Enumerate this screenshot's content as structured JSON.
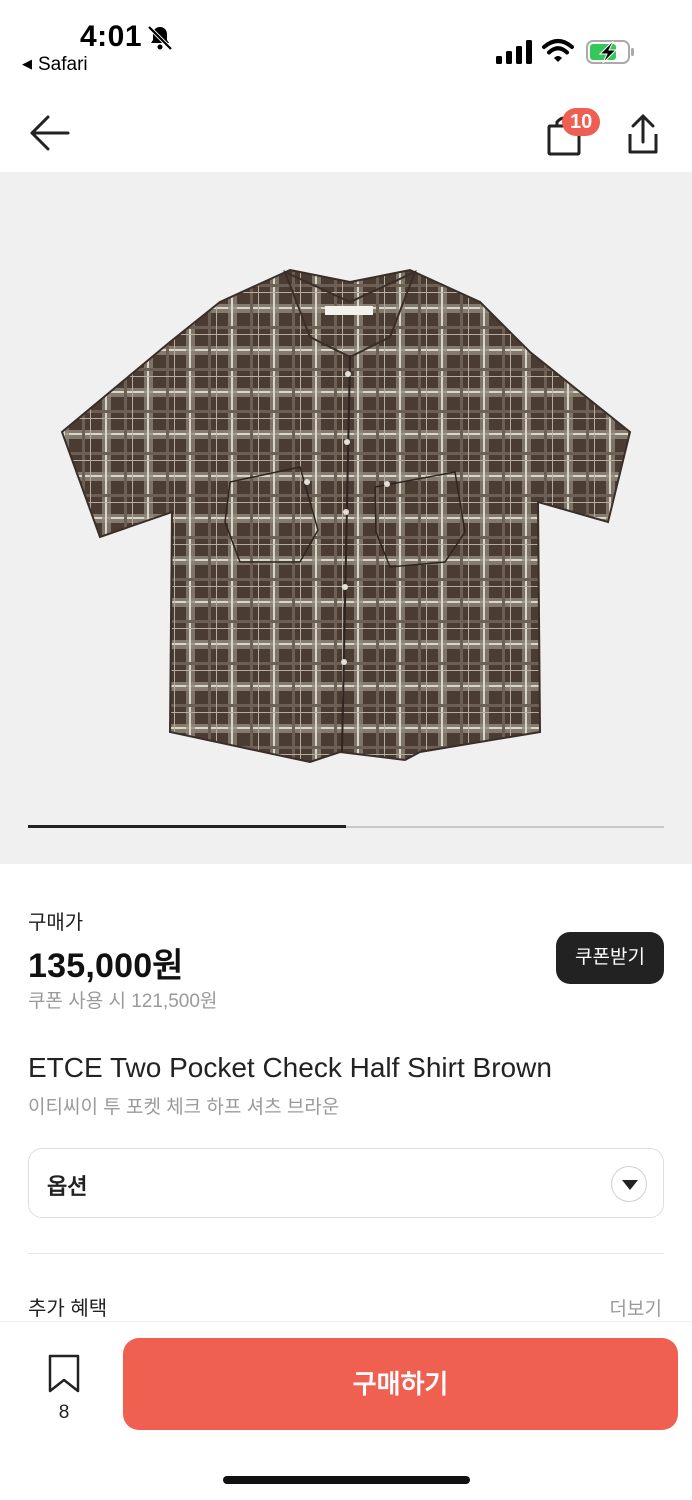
{
  "status_bar": {
    "time": "4:01",
    "back_app": "Safari",
    "icons": [
      "bell-off-icon",
      "signal-icon",
      "wifi-icon",
      "battery-charging-icon"
    ]
  },
  "header": {
    "icons": [
      "back-arrow-icon",
      "shopping-bag-icon",
      "share-icon"
    ],
    "bag_badge": "10"
  },
  "gallery": {
    "image_alt": "shirt",
    "progress": 0.5
  },
  "price": {
    "label": "구매가",
    "value": "135,000원",
    "coupon_text": "쿠폰 사용 시 121,500원",
    "coupon_button": "쿠폰받기"
  },
  "product": {
    "name_en": "ETCE Two Pocket Check Half Shirt Brown",
    "name_ko": "이티씨이 투 포켓 체크 하프 셔츠 브라운"
  },
  "option": {
    "label": "옵션"
  },
  "benefits": {
    "label": "추가 혜택",
    "more": "더보기"
  },
  "bottom_bar": {
    "bookmark_count": "8",
    "buy_label": "구매하기"
  },
  "colors": {
    "accent": "#ef6051",
    "badge": "#ee5e52",
    "dark_button": "#222222",
    "image_bg": "#f0f0f0"
  }
}
